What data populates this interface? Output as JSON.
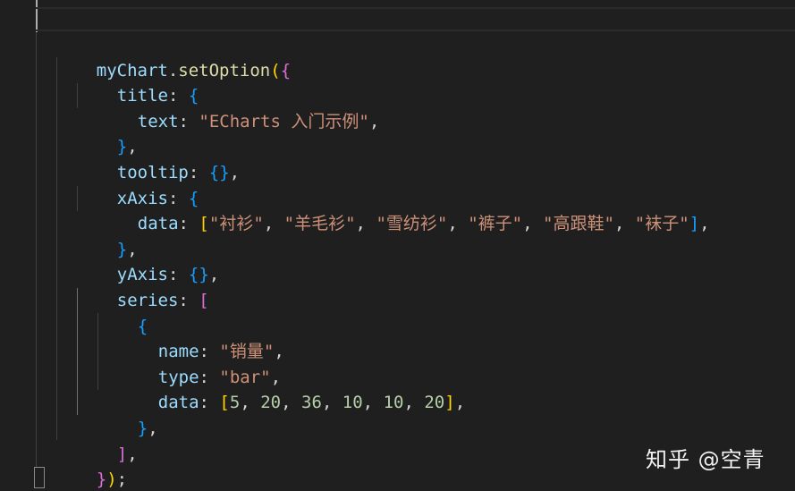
{
  "editor": {
    "tokens": {
      "myChart": "myChart",
      "dot": ".",
      "setOption": "setOption",
      "open_paren": "(",
      "close_paren": ")",
      "open_brace": "{",
      "close_brace": "}",
      "open_bracket": "[",
      "close_bracket": "]",
      "comma": ",",
      "semicolon": ";",
      "colon": ": ",
      "sep": ", ",
      "title_key": "title",
      "text_key": "text",
      "text_value": "\"ECharts 入门示例\"",
      "tooltip_key": "tooltip",
      "xAxis_key": "xAxis",
      "data_key": "data",
      "xaxis_categories": [
        "\"衬衫\"",
        "\"羊毛衫\"",
        "\"雪纺衫\"",
        "\"裤子\"",
        "\"高跟鞋\"",
        "\"袜子\""
      ],
      "yAxis_key": "yAxis",
      "series_key": "series",
      "name_key": "name",
      "name_value": "\"销量\"",
      "type_key": "type",
      "type_value": "\"bar\"",
      "series_values": [
        "5",
        "20",
        "36",
        "10",
        "10",
        "20"
      ]
    }
  },
  "watermark": {
    "text": "知乎 @空青"
  },
  "colors": {
    "background": "#1f1f1f",
    "variable": "#9cdcfe",
    "function": "#dcdcaa",
    "string": "#ce9178",
    "number": "#b5cea8",
    "bracket_level1": "#ffd700",
    "bracket_level2": "#da70d6",
    "bracket_level3": "#179fff"
  }
}
